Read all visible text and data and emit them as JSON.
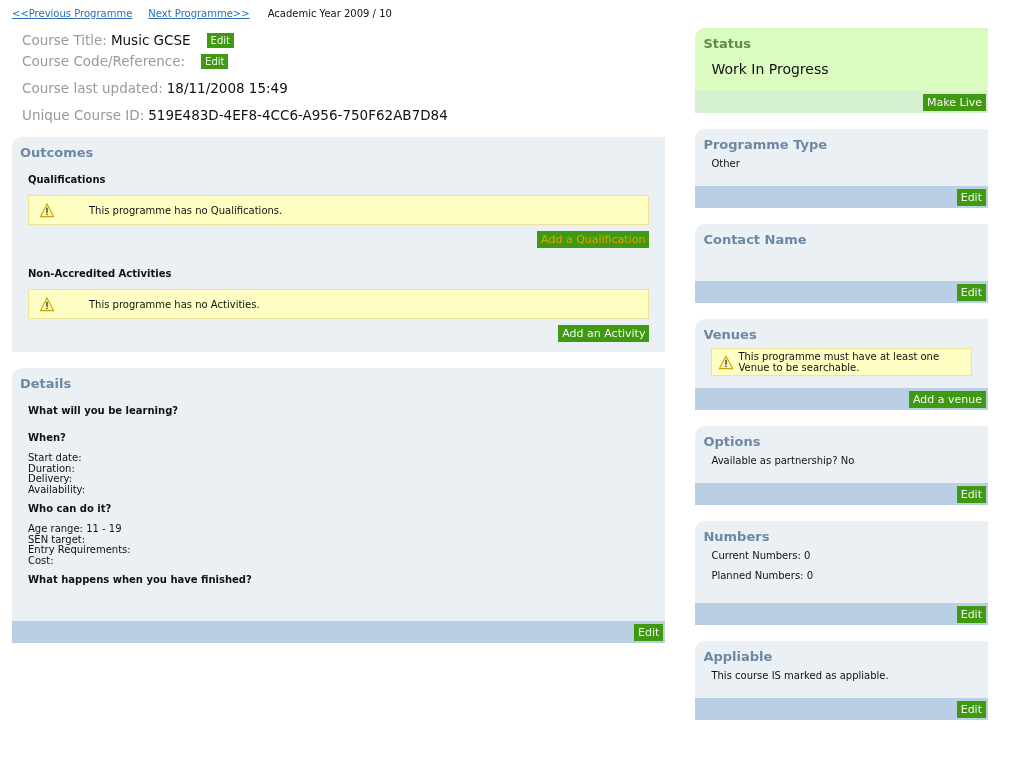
{
  "nav": {
    "previous": "<<Previous Programme",
    "next": "Next Programme>>",
    "year": "Academic Year 2009 / 10"
  },
  "course_info": [
    {
      "label": "Course Title:",
      "value": "Music GCSE",
      "edit": "Edit"
    },
    {
      "label": "Course Code/Reference:",
      "edit": "Edit"
    },
    {
      "label": "Course last updated:",
      "value": "18/11/2008 15:49"
    },
    {
      "label": "Unique Course ID:",
      "value": "519E483D-4EF8-4CC6-A956-750F62AB7D84"
    }
  ],
  "outcomes": {
    "title": "Outcomes",
    "groups": [
      {
        "heading": "Qualifications",
        "warning": "This programme has no Qualifications.",
        "button": "Add a Qualification",
        "hovered": true
      },
      {
        "heading": "Non-Accredited Activities",
        "warning": "This programme has no Activities.",
        "button": "Add an Activity",
        "hovered": false
      }
    ]
  },
  "details": {
    "title": "Details",
    "sections": [
      {
        "heading": "What will you be learning?"
      },
      {
        "heading": "When?",
        "lines": [
          "Start date:",
          "Duration:",
          "Delivery:",
          "Availability:"
        ]
      },
      {
        "heading": "Who can do it?",
        "lines": [
          "Age range: 11 - 19",
          "SEN target:",
          "Entry Requirements:",
          "Cost:"
        ]
      },
      {
        "heading": "What happens when you have finished?"
      }
    ],
    "button": "Edit"
  },
  "panels": [
    {
      "kind": "status",
      "title": "Status",
      "items": [
        {
          "kind": "value",
          "text": "Work In Progress"
        }
      ],
      "button": "Make Live"
    },
    {
      "kind": "normal",
      "title": "Programme Type",
      "items": [
        {
          "kind": "text",
          "text": "Other"
        }
      ],
      "button": "Edit"
    },
    {
      "kind": "normal",
      "title": "Contact Name",
      "button": "Edit"
    },
    {
      "kind": "normal",
      "title": "Venues",
      "items": [
        {
          "kind": "warning",
          "text": "This programme must have at least one Venue to be searchable."
        }
      ],
      "button": "Add a venue"
    },
    {
      "kind": "normal",
      "title": "Options",
      "items": [
        {
          "kind": "text",
          "text": "Available as partnership? No"
        }
      ],
      "button": "Edit"
    },
    {
      "kind": "normal",
      "title": "Numbers",
      "items": [
        {
          "kind": "text",
          "text": "Current Numbers: 0"
        },
        {
          "kind": "text",
          "text": "Planned Numbers: 0"
        }
      ],
      "button": "Edit"
    },
    {
      "kind": "normal",
      "title": "Appliable",
      "items": [
        {
          "kind": "text",
          "text": "This course IS marked as appliable."
        }
      ],
      "button": "Edit"
    }
  ]
}
